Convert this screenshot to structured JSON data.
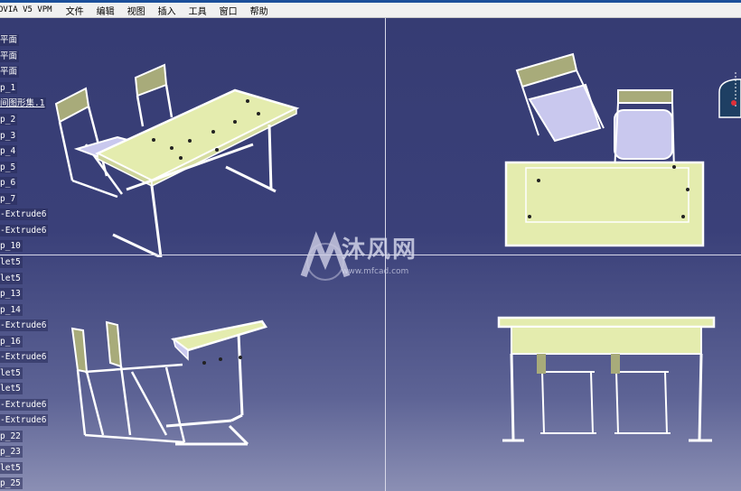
{
  "menubar": {
    "app": "OVIA V5 VPM",
    "items": [
      "文件",
      "编辑",
      "视图",
      "插入",
      "工具",
      "窗口",
      "帮助"
    ]
  },
  "tree": {
    "items": [
      "平面",
      "平面",
      "平面",
      "p_1",
      "间图形集.1",
      "p_2",
      "p_3",
      "p_4",
      "p_5",
      "p_6",
      "p_7",
      "-Extrude6",
      "-Extrude6",
      "p_10",
      "let5",
      "let5",
      "p_13",
      "p_14",
      "-Extrude6",
      "p_16",
      "-Extrude6",
      "let5",
      "let5",
      "-Extrude6",
      "-Extrude6",
      "p_22",
      "p_23",
      "let5",
      "p_25"
    ]
  },
  "watermark": {
    "text": "沐风网",
    "url": "www.mfcad.com"
  },
  "colors": {
    "desk": "#e4ecae",
    "seat": "#c9c8ee",
    "back": "#a8ab7a",
    "frame": "#ffffff",
    "axis": "#e0303a"
  }
}
